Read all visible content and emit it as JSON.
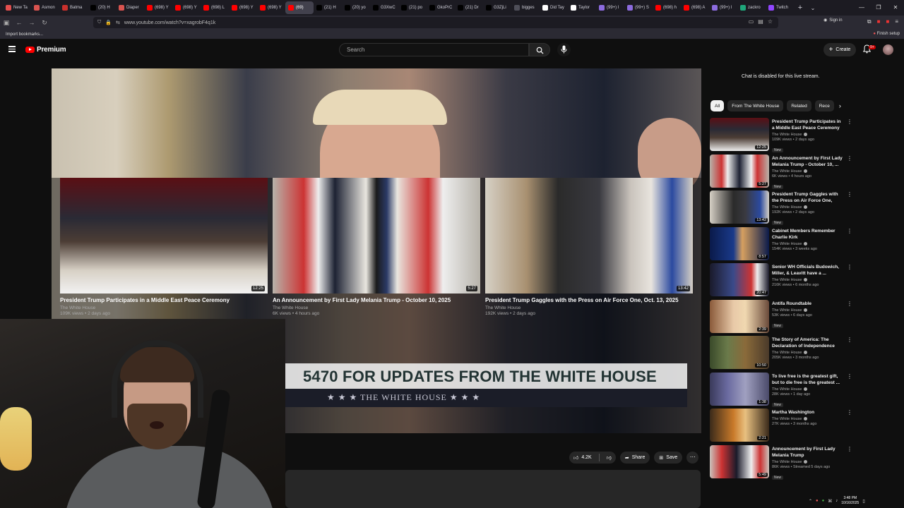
{
  "browser": {
    "tabs": [
      {
        "label": "New Ta",
        "color": "#e34e4e"
      },
      {
        "label": "Asmon",
        "color": "#d9534f"
      },
      {
        "label": "Batma",
        "color": "#c9302c"
      },
      {
        "label": "(20) H",
        "color": "#000000"
      },
      {
        "label": "Diaper",
        "color": "#d9534f"
      },
      {
        "label": "(698) Y",
        "color": "#ff0000"
      },
      {
        "label": "(698) Y",
        "color": "#ff0000"
      },
      {
        "label": "(698) L",
        "color": "#ff0000"
      },
      {
        "label": "(698) Y",
        "color": "#ff0000"
      },
      {
        "label": "(698) Y",
        "color": "#ff0000"
      },
      {
        "label": "(69)",
        "color": "#ff0000",
        "active": true
      },
      {
        "label": "(21) H",
        "color": "#000000"
      },
      {
        "label": "(20) yo",
        "color": "#000000"
      },
      {
        "label": "G3XwC",
        "color": "#000000"
      },
      {
        "label": "(21) po",
        "color": "#000000"
      },
      {
        "label": "GkoPrC",
        "color": "#000000"
      },
      {
        "label": "(21) Dr",
        "color": "#000000"
      },
      {
        "label": "G3ZjLi",
        "color": "#000000"
      },
      {
        "label": "bigges",
        "color": "#4e4e58"
      },
      {
        "label": "Did Tay",
        "color": "#ffffff"
      },
      {
        "label": "Taylor",
        "color": "#ffffff"
      },
      {
        "label": "(99+) I",
        "color": "#8c6bde"
      },
      {
        "label": "(99+) S",
        "color": "#8c6bde"
      },
      {
        "label": "(698) h",
        "color": "#ff0000"
      },
      {
        "label": "(698) A",
        "color": "#ff0000"
      },
      {
        "label": "(99+) I",
        "color": "#8c6bde"
      },
      {
        "label": "zackro",
        "color": "#1fa67a"
      },
      {
        "label": "Twitch",
        "color": "#9146ff"
      }
    ],
    "url": "www.youtube.com/watch?v=xagrobF4q1k",
    "signin": "Sign in",
    "bookmarks_label": "Import bookmarks...",
    "finish_setup": "Finish setup"
  },
  "yt": {
    "logo_text": "Premium",
    "search_placeholder": "Search",
    "create_label": "Create",
    "notif_badge": "9+"
  },
  "player": {
    "banner_text": "5470 FOR UPDATES FROM THE WHITE HOUSE",
    "banner_sub": "★ ★ ★   THE WHITE HOUSE   ★ ★ ★",
    "endcards": [
      {
        "title": "President Trump Participates in a Middle East Peace Ceremony",
        "channel": "The White House",
        "meta": "109K views • 2 days ago",
        "duration": "12:25"
      },
      {
        "title": "An Announcement by First Lady Melania Trump - October 10, 2025",
        "channel": "The White House",
        "meta": "6K views • 4 hours ago",
        "duration": "5:27"
      },
      {
        "title": "President Trump Gaggles with the Press on Air Force One, Oct. 13, 2025",
        "channel": "The White House",
        "meta": "192K views • 2 days ago",
        "duration": "13:42"
      }
    ]
  },
  "actions": {
    "like_count": "4.2K",
    "share_label": "Share",
    "save_label": "Save"
  },
  "sidebar": {
    "chat_disabled": "Chat is disabled for this live stream.",
    "chips": [
      "All",
      "From The White House",
      "Related",
      "Rece"
    ],
    "items": [
      {
        "title": "President Trump Participates in a Middle East Peace Ceremony",
        "channel": "The White House",
        "views": "109K views • 2 days ago",
        "duration": "12:25",
        "badge": "New"
      },
      {
        "title": "An Announcement by First Lady Melania Trump - October 10, ...",
        "channel": "The White House",
        "views": "6K views • 4 hours ago",
        "duration": "5:27",
        "badge": "New"
      },
      {
        "title": "President Trump Gaggles with the Press on Air Force One, Oc...",
        "channel": "The White House",
        "views": "192K views • 2 days ago",
        "duration": "13:42",
        "badge": "New"
      },
      {
        "title": "Cabinet Members Remember Charlie Kirk",
        "channel": "The White House",
        "views": "154K views • 3 weeks ago",
        "duration": "8:57",
        "badge": ""
      },
      {
        "title": "Senior WH Officials Budowich, Miller, & Leavitt have a ...",
        "channel": "The White House",
        "views": "216K views • 6 months ago",
        "duration": "20:47",
        "badge": ""
      },
      {
        "title": "Antifa Roundtable",
        "channel": "The White House",
        "views": "53K views • 6 days ago",
        "duration": "2:39",
        "badge": "New"
      },
      {
        "title": "The Story of America: The Declaration of Independence",
        "channel": "The White House",
        "views": "205K views • 3 months ago",
        "duration": "10:50",
        "badge": ""
      },
      {
        "title": "To live free is the greatest gift, but to die free is the greatest ...",
        "channel": "The White House",
        "views": "28K views • 1 day ago",
        "duration": "1:38",
        "badge": "New"
      },
      {
        "title": "Martha Washington",
        "channel": "The White House",
        "views": "27K views • 3 months ago",
        "duration": "2:21",
        "badge": ""
      },
      {
        "title": "Announcement by First Lady Melania Trump",
        "channel": "The White House",
        "views": "86K views • Streamed 5 days ago",
        "duration": "5:49",
        "badge": "New"
      }
    ]
  },
  "taskbar": {
    "time": "3:48 PM",
    "date": "10/16/2025"
  }
}
